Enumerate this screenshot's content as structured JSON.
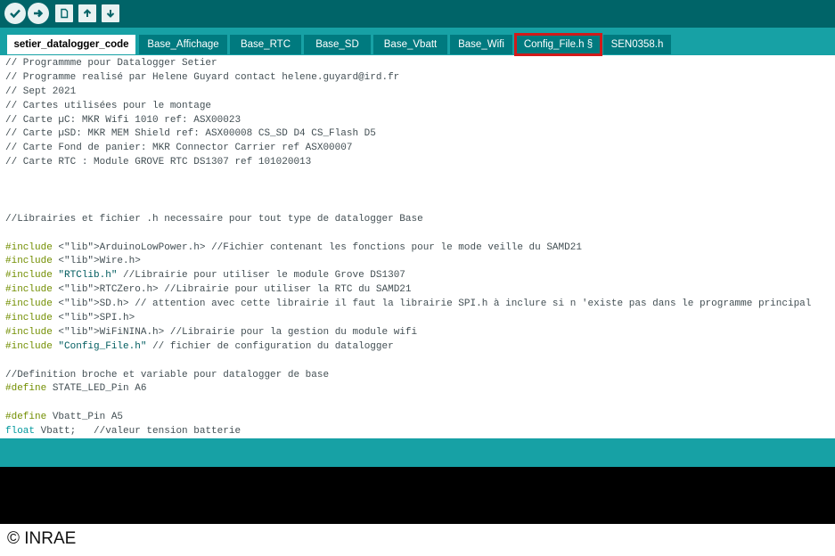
{
  "toolbar": {
    "buttons": [
      {
        "name": "verify-button",
        "icon": "check-icon"
      },
      {
        "name": "upload-button",
        "icon": "arrow-right-icon"
      },
      {
        "name": "new-button",
        "icon": "new-file-icon"
      },
      {
        "name": "open-button",
        "icon": "arrow-up-icon"
      },
      {
        "name": "save-button",
        "icon": "arrow-down-icon"
      }
    ]
  },
  "tabs": [
    {
      "label": "setier_datalogger_code",
      "active": true
    },
    {
      "label": "Base_Affichage"
    },
    {
      "label": "Base_RTC"
    },
    {
      "label": "Base_SD"
    },
    {
      "label": "Base_Vbatt"
    },
    {
      "label": "Base_Wifi"
    },
    {
      "label": "Config_File.h §",
      "highlighted": true
    },
    {
      "label": "SEN0358.h"
    }
  ],
  "code_lines": [
    "// Programmme pour Datalogger Setier",
    "// Programme realisé par Helene Guyard contact helene.guyard@ird.fr",
    "// Sept 2021",
    "// Cartes utilisées pour le montage",
    "// Carte µC: MKR Wifi 1010 ref: ASX00023",
    "// Carte µSD: MKR MEM Shield ref: ASX00008 CS_SD D4 CS_Flash D5",
    "// Carte Fond de panier: MKR Connector Carrier ref ASX00007",
    "// Carte RTC : Module GROVE RTC DS1307 ref 101020013",
    "",
    "",
    "",
    "//Librairies et fichier .h necessaire pour tout type de datalogger Base",
    "",
    "#include <ArduinoLowPower.h> //Fichier contenant les fonctions pour le mode veille du SAMD21",
    "#include <Wire.h>",
    "#include \"RTClib.h\" //Librairie pour utiliser le module Grove DS1307",
    "#include <RTCZero.h> //Librairie pour utiliser la RTC du SAMD21",
    "#include <SD.h> // attention avec cette librairie il faut la librairie SPI.h à inclure si n 'existe pas dans le programme principal",
    "#include <SPI.h>",
    "#include <WiFiNINA.h> //Librairie pour la gestion du module wifi",
    "#include \"Config_File.h\" // fichier de configuration du datalogger",
    "",
    "//Definition broche et variable pour datalogger de base",
    "#define STATE_LED_Pin A6",
    "",
    "#define Vbatt_Pin A5",
    "float Vbatt;   //valeur tension batterie"
  ],
  "footer": {
    "copyright": "© INRAE"
  },
  "colors": {
    "toolbar": "#006468",
    "tabbar": "#17a1a5",
    "tab": "#007a7f",
    "highlight": "#d11a1a",
    "library": "#d35400",
    "keyword": "#728e00"
  }
}
